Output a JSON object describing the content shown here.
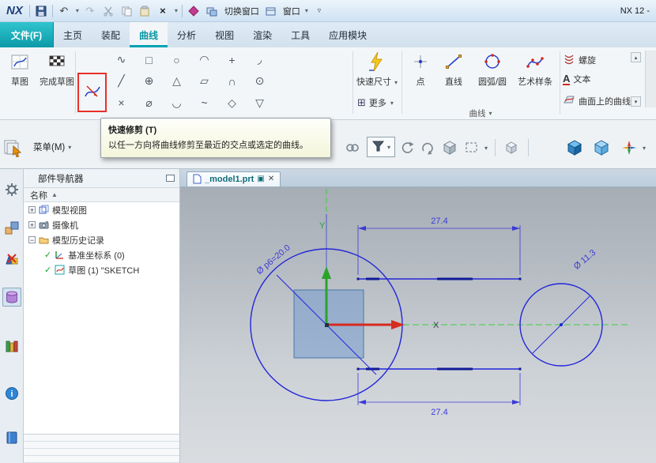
{
  "icons": {
    "dropdown": "▾",
    "up_arrow": "▴",
    "down_arrow": "▾",
    "customize": "▿",
    "sort_ascending": "▲",
    "undo": "↶",
    "redo": "↷",
    "delete": "×",
    "close": "✕",
    "restore": "▣",
    "more_grid": "⊞",
    "text_tool": "A",
    "info_i": "i"
  },
  "titlebar": {
    "logo": "NX",
    "window_title": "NX 12 -",
    "switch_window_label": "切换窗口",
    "window_label": "窗口"
  },
  "ribbon_tabs": {
    "file": "文件(F)",
    "items": [
      "主页",
      "装配",
      "曲线",
      "分析",
      "视图",
      "渲染",
      "工具",
      "应用模块"
    ],
    "active_tab": "曲线"
  },
  "ribbon": {
    "sketch_label": "草图",
    "finish_sketch_label": "完成草图",
    "quick_dim_label": "快速尺寸",
    "more_label": "更多",
    "point_label": "点",
    "line_label": "直线",
    "arc_circle_label": "圆弧/圆",
    "art_spline_label": "艺术样条",
    "helix_label": "螺旋",
    "text_label": "文本",
    "curve_on_surface_label": "曲面上的曲线",
    "curve_group_label": "曲线",
    "grid_glyphs": [
      "∿",
      "□",
      "○",
      "◠",
      "+",
      "◞",
      "╱",
      "⊕",
      "△",
      "▱",
      "∩",
      "⊙",
      "×",
      "⌀",
      "◡",
      "~",
      "◇",
      "▽"
    ]
  },
  "tooltip": {
    "title": "快速修剪 (T)",
    "body": "以任一方向将曲线修剪至最近的交点或选定的曲线。"
  },
  "toolbar": {
    "menu_label": "菜单(M)"
  },
  "navigator": {
    "title": "部件导航器",
    "name_column": "名称",
    "rows": [
      {
        "expander": "+",
        "label": "模型视图"
      },
      {
        "expander": "+",
        "label": "摄像机"
      },
      {
        "expander": "−",
        "label": "模型历史记录"
      },
      {
        "check": "✓",
        "label": "基准坐标系 (0)"
      },
      {
        "check": "✓",
        "label": "草图 (1) \"SKETCH"
      }
    ]
  },
  "viewport": {
    "tab_label": "_model1.prt",
    "dim_top": "27.4",
    "dim_bottom": "27.4",
    "dim_diameter_large": "Ø p6=20.0",
    "dim_diameter_small": "Ø 11.3",
    "axis_x": "X",
    "axis_y": "Y"
  }
}
